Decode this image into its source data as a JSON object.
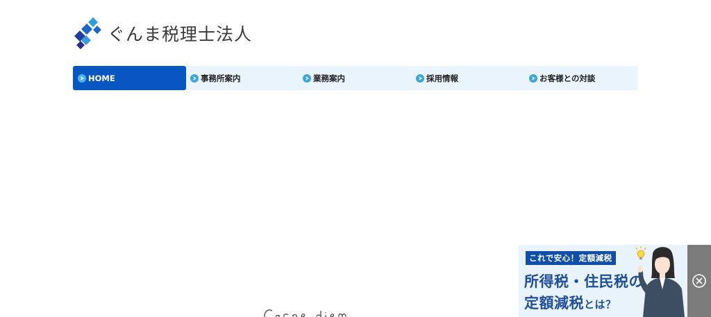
{
  "site": {
    "name": "ぐんま税理士法人"
  },
  "nav": {
    "items": [
      {
        "label": "HOME",
        "active": true
      },
      {
        "label": "事務所案内",
        "active": false
      },
      {
        "label": "業務案内",
        "active": false
      },
      {
        "label": "採用情報",
        "active": false
      },
      {
        "label": "お客様との対談",
        "active": false
      }
    ]
  },
  "hero": {
    "handwriting": "Carpe diem"
  },
  "ad": {
    "badge": "これで安心！定額減税",
    "line1": "所得税・住民税の",
    "line2_main": "定額減税",
    "line2_suffix": "とは？"
  },
  "colors": {
    "nav_active": "#0856c2",
    "nav_bg": "#eaf4fd",
    "nav_dot": "#38a6dc",
    "ad_text": "#1f4f9a",
    "ad_badge": "#0f4fa8",
    "close_bar": "#7b7b7b"
  }
}
